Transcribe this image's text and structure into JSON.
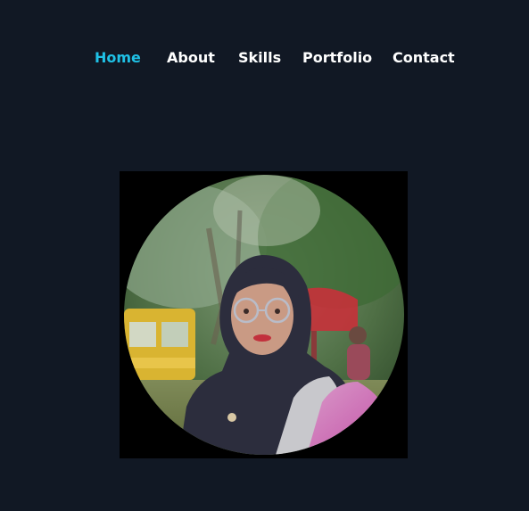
{
  "nav": {
    "items": [
      {
        "label": "Home",
        "active": true
      },
      {
        "label": "About",
        "active": false
      },
      {
        "label": "Skills",
        "active": false
      },
      {
        "label": "Portfolio",
        "active": false
      },
      {
        "label": "Contact",
        "active": false
      }
    ],
    "active_color": "#1fc1e6",
    "text_color": "#ffffff"
  },
  "colors": {
    "background": "#111824",
    "photo_frame": "#000000"
  },
  "profile": {
    "image": "portrait-photo"
  }
}
